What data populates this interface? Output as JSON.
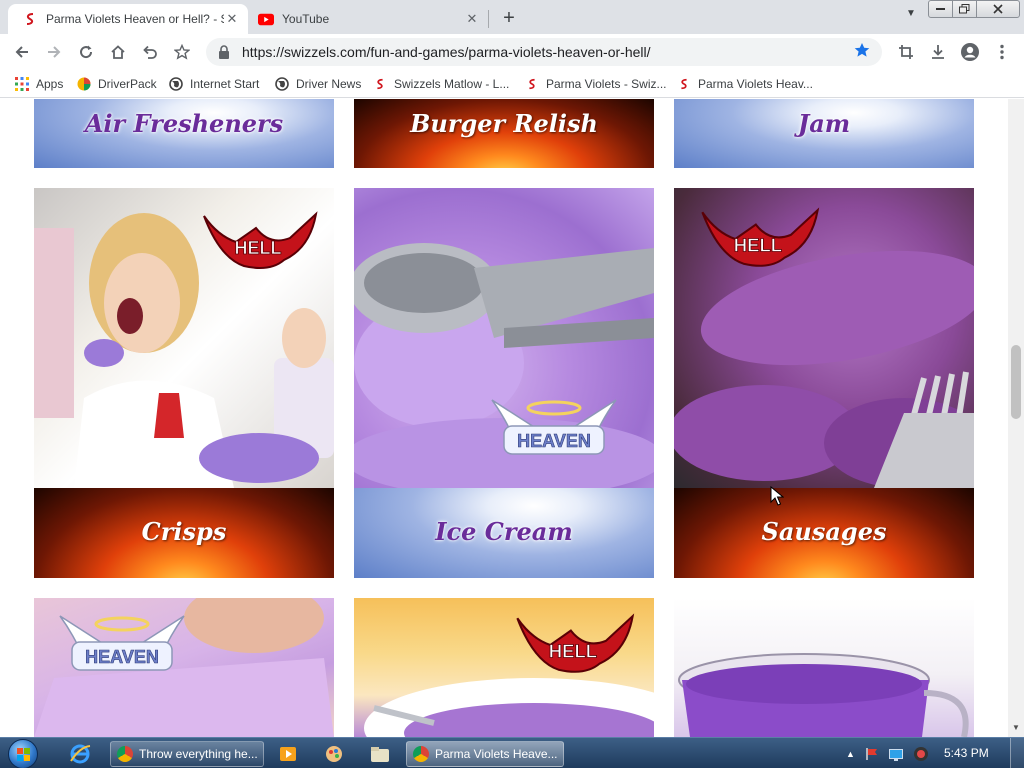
{
  "browser": {
    "tabs": [
      {
        "title": "Parma Violets Heaven or Hell? - Sw",
        "favicon": "swizzels-favicon",
        "active": true
      },
      {
        "title": "YouTube",
        "favicon": "youtube-icon",
        "active": false
      }
    ],
    "address": {
      "url": "https://swizzels.com/fun-and-games/parma-violets-heaven-or-hell/",
      "bookmarked": true
    },
    "bookmarks": [
      {
        "label": "Apps",
        "icon": "apps-grid-icon"
      },
      {
        "label": "DriverPack",
        "icon": "driverpack-icon"
      },
      {
        "label": "Internet Start",
        "icon": "globe-icon"
      },
      {
        "label": "Driver News",
        "icon": "globe-icon"
      },
      {
        "label": "Swizzels Matlow - L...",
        "icon": "swizzels-favicon"
      },
      {
        "label": "Parma Violets - Swiz...",
        "icon": "swizzels-favicon"
      },
      {
        "label": "Parma Violets Heav...",
        "icon": "swizzels-favicon"
      }
    ]
  },
  "page": {
    "top_row": [
      {
        "label": "Air Fresheners",
        "verdict": "heaven"
      },
      {
        "label": "Burger Relish",
        "verdict": "hell"
      },
      {
        "label": "Jam",
        "verdict": "heaven"
      }
    ],
    "middle_row": [
      {
        "label": "Crisps",
        "verdict": "hell",
        "badge": "HELL",
        "photo": "woman-with-crisps"
      },
      {
        "label": "Ice Cream",
        "verdict": "heaven",
        "badge": "HEAVEN",
        "photo": "ice-cream-scoop"
      },
      {
        "label": "Sausages",
        "verdict": "hell",
        "badge": "HELL",
        "photo": "purple-sausages"
      }
    ],
    "bottom_row": [
      {
        "verdict": "heaven",
        "badge": "HEAVEN",
        "photo": "marshmallow"
      },
      {
        "verdict": "hell",
        "badge": "HELL",
        "photo": "purple-dessert"
      },
      {
        "photo": "purple-tea-cup"
      }
    ]
  },
  "taskbar": {
    "tasks": [
      {
        "label": "Throw everything he...",
        "icon": "chrome-icon",
        "active": false
      },
      {
        "label": "Parma Violets Heave...",
        "icon": "chrome-icon",
        "active": true
      }
    ],
    "clock": "5:43 PM"
  },
  "colors": {
    "heaven_text": "#6a2c9a",
    "hell_badge": "#c4121a",
    "bookmark_star": "#1a73e8"
  }
}
